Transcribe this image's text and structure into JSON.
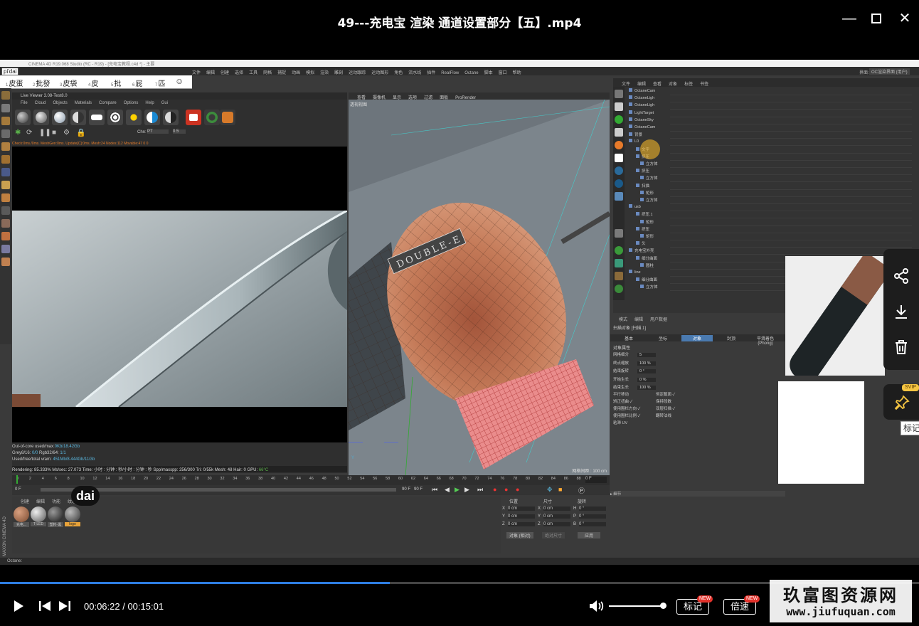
{
  "window": {
    "title": "49---充电宝 渲染 通道设置部分【五】.mp4",
    "minimize": "—",
    "maximize": "☐",
    "close": "✕"
  },
  "c4d": {
    "app_title": "CINEMA 4D R19.068 Studio (RC - R19) - [充电宝教程.c4d *] - 主要",
    "layout_label": "界面:",
    "layout_value": "OC渲染界面 (用户)",
    "menu": [
      "文件",
      "编辑",
      "创建",
      "选择",
      "工具",
      "网格",
      "捕捉",
      "动画",
      "模拟",
      "渲染",
      "雕刻",
      "运动跟踪",
      "运动图形",
      "角色",
      "流水线",
      "插件",
      "RealFlow",
      "Octane",
      "脚本",
      "窗口",
      "帮助"
    ],
    "input_toolbar": [
      {
        "num": "1",
        "text": "皮蛋"
      },
      {
        "num": "2",
        "text": "批發"
      },
      {
        "num": "3",
        "text": "皮袋"
      },
      {
        "num": "4",
        "text": "皮"
      },
      {
        "num": "5",
        "text": "批"
      },
      {
        "num": "6",
        "text": "屁"
      },
      {
        "num": "7",
        "text": "匹"
      }
    ],
    "input_logo": "pi'dai",
    "live_viewer": {
      "title": "Live Viewer 3.08-Test8.0",
      "menu": [
        "File",
        "Cloud",
        "Objects",
        "Materials",
        "Compare",
        "Options",
        "Help",
        "Gui"
      ],
      "channel_label": "Chn:",
      "channel_value": "PT",
      "channel_num": "0.5",
      "log": "Check:0ms./0ms. MeshGen:0ms. Update[C]:0ms. Mesh:24 Nodes:112 Movable:47  0 0",
      "stats": [
        {
          "label": "Out-of-core used/max:",
          "value": "0Kb/18.42Gb"
        },
        {
          "label": "Grey8/16: ",
          "value": "0/0",
          "label2": "     Rgb32/64: ",
          "value2": "1/1"
        },
        {
          "label": "Used/free/total vram: ",
          "value": "451Mb/8.444Gb/11Gb"
        }
      ],
      "render_status": "Rendering: 85.333%   Ms/sec: 27.073   Time: 小时 : 分钟 : 秒/小时 : 分钟 : 秒   Spp/maxspp: 256/300   Tri: 0/55k   Mesh: 48   Hair: 0   GPU:",
      "gpu_temp": "66°C"
    },
    "viewport": {
      "menu": [
        "查看",
        "摄像机",
        "显示",
        "选项",
        "过滤",
        "面板",
        "ProRender"
      ],
      "label": "透视视图",
      "footer": "网格间距 : 100 cm",
      "logo_text": "DOUBLE-E"
    },
    "object_manager": {
      "menu": [
        "文件",
        "编辑",
        "查看",
        "对象",
        "标签",
        "书签"
      ],
      "rows": [
        "OctaneCam",
        "OctaneLigh",
        "OctaneLigh",
        "LightTarget",
        "OctaneSky",
        "OctaneCam",
        "背景",
        "L0",
        "文字",
        "挤压",
        "立方体",
        "挤压",
        "立方体",
        "扫描",
        "矩形",
        "立方体",
        "usb",
        "挤压.1",
        "矩形",
        "挤压",
        "矩形",
        "头",
        "充电宝外壳",
        "细分曲面",
        "圆柱",
        "line",
        "细分曲面",
        "立方体"
      ]
    },
    "attributes": {
      "menu": [
        "模式",
        "编辑",
        "用户数据"
      ],
      "object_name": "扫描对象 [扫描.1]",
      "tabs": [
        "基本",
        "坐标",
        "对象",
        "封顶",
        "平滑着色(Phong)"
      ],
      "active_tab": "对象",
      "section": "对象属性",
      "rows": [
        {
          "label": "网格细分",
          "value": "5"
        },
        {
          "label": "终点缩放",
          "value": "100 %"
        },
        {
          "label": "结束旋转",
          "value": "0 °"
        },
        {
          "label": "开始生长",
          "value": "0 %"
        },
        {
          "label": "结束生长",
          "value": "100 %"
        }
      ],
      "checks": [
        [
          "平行移动",
          "恒定截面 ✓"
        ],
        [
          "矫正扭曲 ✓",
          "保持段数"
        ],
        [
          "使用围栏方向 ✓",
          "双层扫描 ✓"
        ],
        [
          "使用围栏比例 ✓",
          "翻转法线"
        ],
        [
          "粘滞 UV",
          "",
          ""
        ]
      ],
      "footer": "▸ 细节"
    },
    "timeline": {
      "ticks": [
        "0",
        "2",
        "4",
        "6",
        "8",
        "10",
        "12",
        "14",
        "16",
        "18",
        "20",
        "22",
        "24",
        "26",
        "28",
        "30",
        "32",
        "34",
        "36",
        "38",
        "40",
        "42",
        "44",
        "46",
        "48",
        "50",
        "52",
        "54",
        "56",
        "58",
        "60",
        "62",
        "64",
        "66",
        "68",
        "70",
        "72",
        "74",
        "76",
        "78",
        "80",
        "82",
        "84",
        "86",
        "88",
        "90"
      ],
      "current": "0 F",
      "start": "0 F",
      "end": "90 F",
      "end2": "90 F",
      "frame_box": "0 F"
    },
    "materials": {
      "menu": [
        "创建",
        "编辑",
        "功能",
        "纹理"
      ],
      "items": [
        "充电...",
        "T-LED",
        "塑料-黑",
        "logo"
      ]
    },
    "coordinates": {
      "headers": [
        "位置",
        "尺寸",
        "旋转"
      ],
      "rows": [
        [
          "X",
          "0 cm",
          "X",
          "0 cm",
          "H",
          "0 °"
        ],
        [
          "Y",
          "0 cm",
          "Y",
          "0 cm",
          "P",
          "0 °"
        ],
        [
          "Z",
          "0 cm",
          "Z",
          "0 cm",
          "B",
          "0 °"
        ]
      ],
      "mode": "对象 (相对)",
      "size_mode": "绝对尺寸",
      "apply": "应用"
    },
    "statusbar": "Octane:",
    "cinema_logo": "MAXON CINEMA 4D"
  },
  "overlay": {
    "dai": "dai",
    "svip": "SVIP",
    "tooltip": "标记"
  },
  "player": {
    "current_time": "00:06:22",
    "total_time": "00:15:01",
    "time_sep": " / ",
    "progress": 0.424,
    "mark_label": "标记",
    "speed_label": "倍速",
    "new_badge": "NEW",
    "accent": "#2e7de1"
  },
  "watermark": {
    "line1": "玖富图资源网",
    "line2": "www.jiufuquan.com"
  }
}
